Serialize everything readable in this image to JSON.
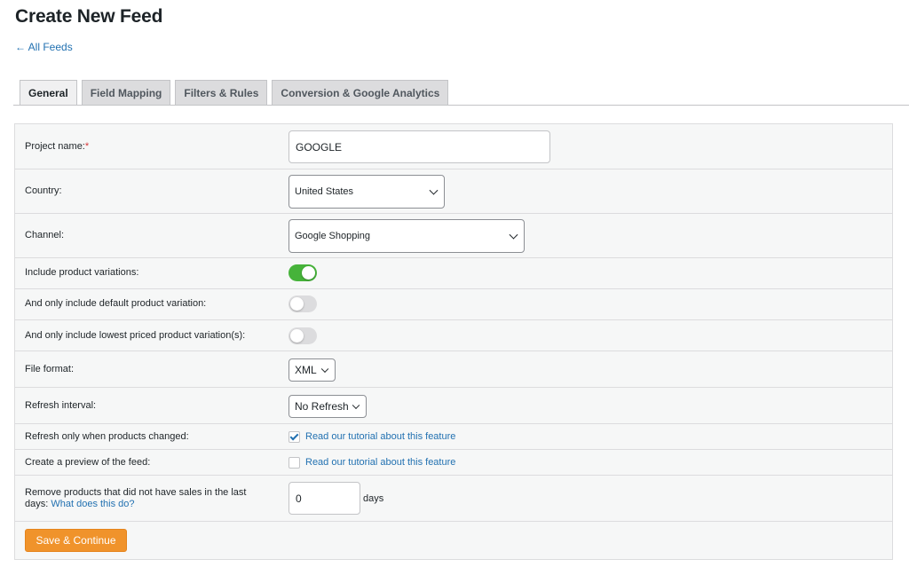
{
  "page": {
    "title": "Create New Feed",
    "back_link": "← All Feeds"
  },
  "tabs": [
    {
      "label": "General",
      "active": true
    },
    {
      "label": "Field Mapping",
      "active": false
    },
    {
      "label": "Filters & Rules",
      "active": false
    },
    {
      "label": "Conversion & Google Analytics",
      "active": false
    }
  ],
  "form": {
    "project_name": {
      "label": "Project name:",
      "required_mark": "*",
      "value": "GOOGLE"
    },
    "country": {
      "label": "Country:",
      "value": "United States"
    },
    "channel": {
      "label": "Channel:",
      "value": "Google Shopping"
    },
    "include_variations": {
      "label": "Include product variations:",
      "on": true
    },
    "default_variation": {
      "label": "And only include default product variation:",
      "on": false
    },
    "lowest_priced": {
      "label": "And only include lowest priced product variation(s):",
      "on": false
    },
    "file_format": {
      "label": "File format:",
      "value": "XML"
    },
    "refresh_interval": {
      "label": "Refresh interval:",
      "value": "No Refresh"
    },
    "refresh_changed": {
      "label": "Refresh only when products changed:",
      "checked": true,
      "link": "Read our tutorial about this feature"
    },
    "preview": {
      "label": "Create a preview of the feed:",
      "checked": false,
      "link": "Read our tutorial about this feature"
    },
    "remove_products": {
      "label": "Remove products that did not have sales in the last days:",
      "link": "What does this do?",
      "value": "0",
      "suffix": "days"
    },
    "save_button": "Save & Continue"
  },
  "colors": {
    "accent_blue": "#2271b1",
    "toggle_on": "#46b33a",
    "save_button": "#f0932b",
    "required": "#d63638"
  }
}
